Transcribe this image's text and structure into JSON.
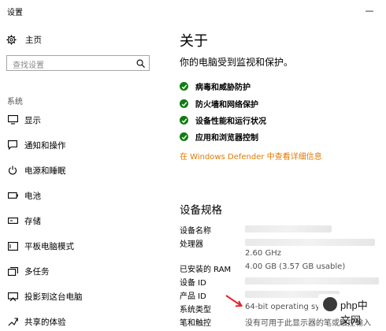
{
  "window": {
    "title": "设置",
    "minimize_glyph": "—"
  },
  "sidebar": {
    "home_label": "主页",
    "search_placeholder": "查找设置",
    "section_label": "系统",
    "items": [
      {
        "label": "显示",
        "icon": "monitor-icon"
      },
      {
        "label": "通知和操作",
        "icon": "notification-icon"
      },
      {
        "label": "电源和睡眠",
        "icon": "power-icon"
      },
      {
        "label": "电池",
        "icon": "battery-icon"
      },
      {
        "label": "存储",
        "icon": "storage-icon"
      },
      {
        "label": "平板电脑模式",
        "icon": "tablet-icon"
      },
      {
        "label": "多任务",
        "icon": "multitask-icon"
      },
      {
        "label": "投影到这台电脑",
        "icon": "project-icon"
      },
      {
        "label": "共享的体验",
        "icon": "shared-icon"
      }
    ]
  },
  "main": {
    "title": "关于",
    "subtitle": "你的电脑受到监视和保护。",
    "protections": [
      "病毒和威胁防护",
      "防火墙和网络保护",
      "设备性能和运行状况",
      "应用和浏览器控制"
    ],
    "defender_link": "在 Windows Defender 中查看详细信息",
    "specs_title": "设备规格",
    "specs": [
      {
        "label": "设备名称",
        "value": ""
      },
      {
        "label": "处理器",
        "value": "2.60 GHz"
      },
      {
        "label": "已安装的 RAM",
        "value": "4.00 GB (3.57 GB usable)"
      },
      {
        "label": "设备 ID",
        "value": ""
      },
      {
        "label": "产品 ID",
        "value": ""
      },
      {
        "label": "系统类型",
        "value": "64-bit operating sy"
      },
      {
        "label": "笔和触控",
        "value": "没有可用于此显示器的笔或触控输入"
      }
    ]
  },
  "watermark": {
    "text": "php中文网"
  },
  "colors": {
    "check": "#107c10",
    "link": "#e07b00"
  }
}
